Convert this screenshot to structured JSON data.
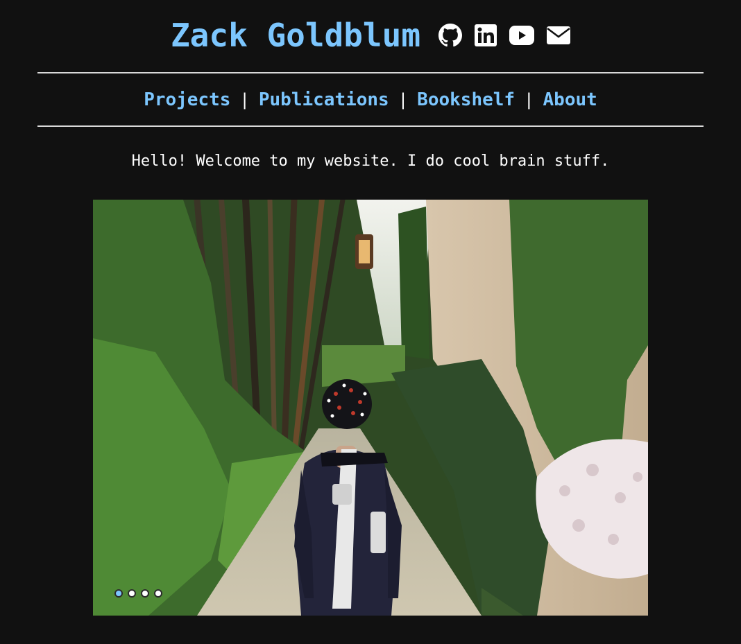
{
  "header": {
    "site_title": "Zack Goldblum",
    "social_links": [
      {
        "icon": "github-icon",
        "label": "GitHub"
      },
      {
        "icon": "linkedin-icon",
        "label": "LinkedIn"
      },
      {
        "icon": "youtube-icon",
        "label": "YouTube"
      },
      {
        "icon": "mail-icon",
        "label": "Email"
      }
    ]
  },
  "nav": {
    "items": [
      {
        "label": "Projects"
      },
      {
        "label": "Publications"
      },
      {
        "label": "Bookshelf"
      },
      {
        "label": "About"
      }
    ],
    "separator": "|"
  },
  "main": {
    "intro": "Hello! Welcome to my website. I do cool brain stuff."
  },
  "slideshow": {
    "slide_count": 4,
    "active_index": 0
  },
  "colors": {
    "background": "#111111",
    "accent": "#7cc6fe",
    "text": "#ffffff",
    "rule": "#d9d9d9"
  }
}
